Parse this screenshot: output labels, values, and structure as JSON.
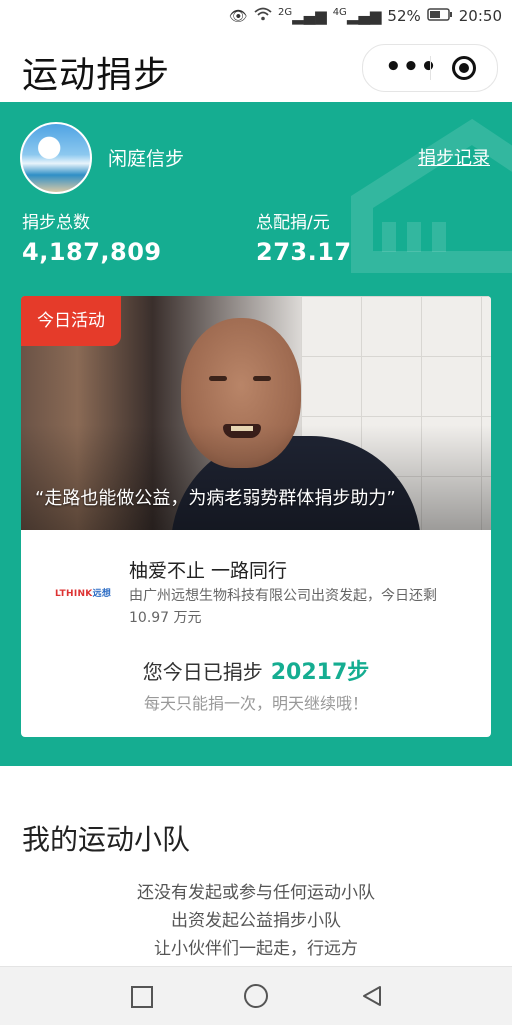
{
  "status_bar": {
    "eye_icon": "eye-icon",
    "signal1": "2G",
    "signal2": "4G",
    "battery": "52%",
    "time": "20:50"
  },
  "header": {
    "title": "运动捐步",
    "more_icon": "•••",
    "close_icon": "target-icon"
  },
  "colors": {
    "primary": "#15ad91",
    "badge": "#e53b2a"
  },
  "profile": {
    "username": "闲庭信步",
    "record_link": "捐步记录",
    "total_steps_label": "捐步总数",
    "total_steps_value": "4,187,809",
    "total_money_label": "总配捐/元",
    "total_money_value": "273.17"
  },
  "activity": {
    "badge": "今日活动",
    "quote": "“走路也能做公益，为病老弱势群体捐步助力”",
    "sponsor_logo_a": "LTHINK",
    "sponsor_logo_b": "远想",
    "campaign_title": "柚爱不止 一路同行",
    "campaign_desc": "由广州远想生物科技有限公司出资发起，今日还剩 10.97 万元",
    "steps_prefix": "您今日已捐步",
    "steps_value": "20217步",
    "hint": "每天只能捐一次，明天继续哦！"
  },
  "team": {
    "title": "我的运动小队",
    "lines": [
      "还没有发起或参与任何运动小队",
      "出资发起公益捐步小队",
      "让小伙伴们一起走，行远方"
    ]
  }
}
